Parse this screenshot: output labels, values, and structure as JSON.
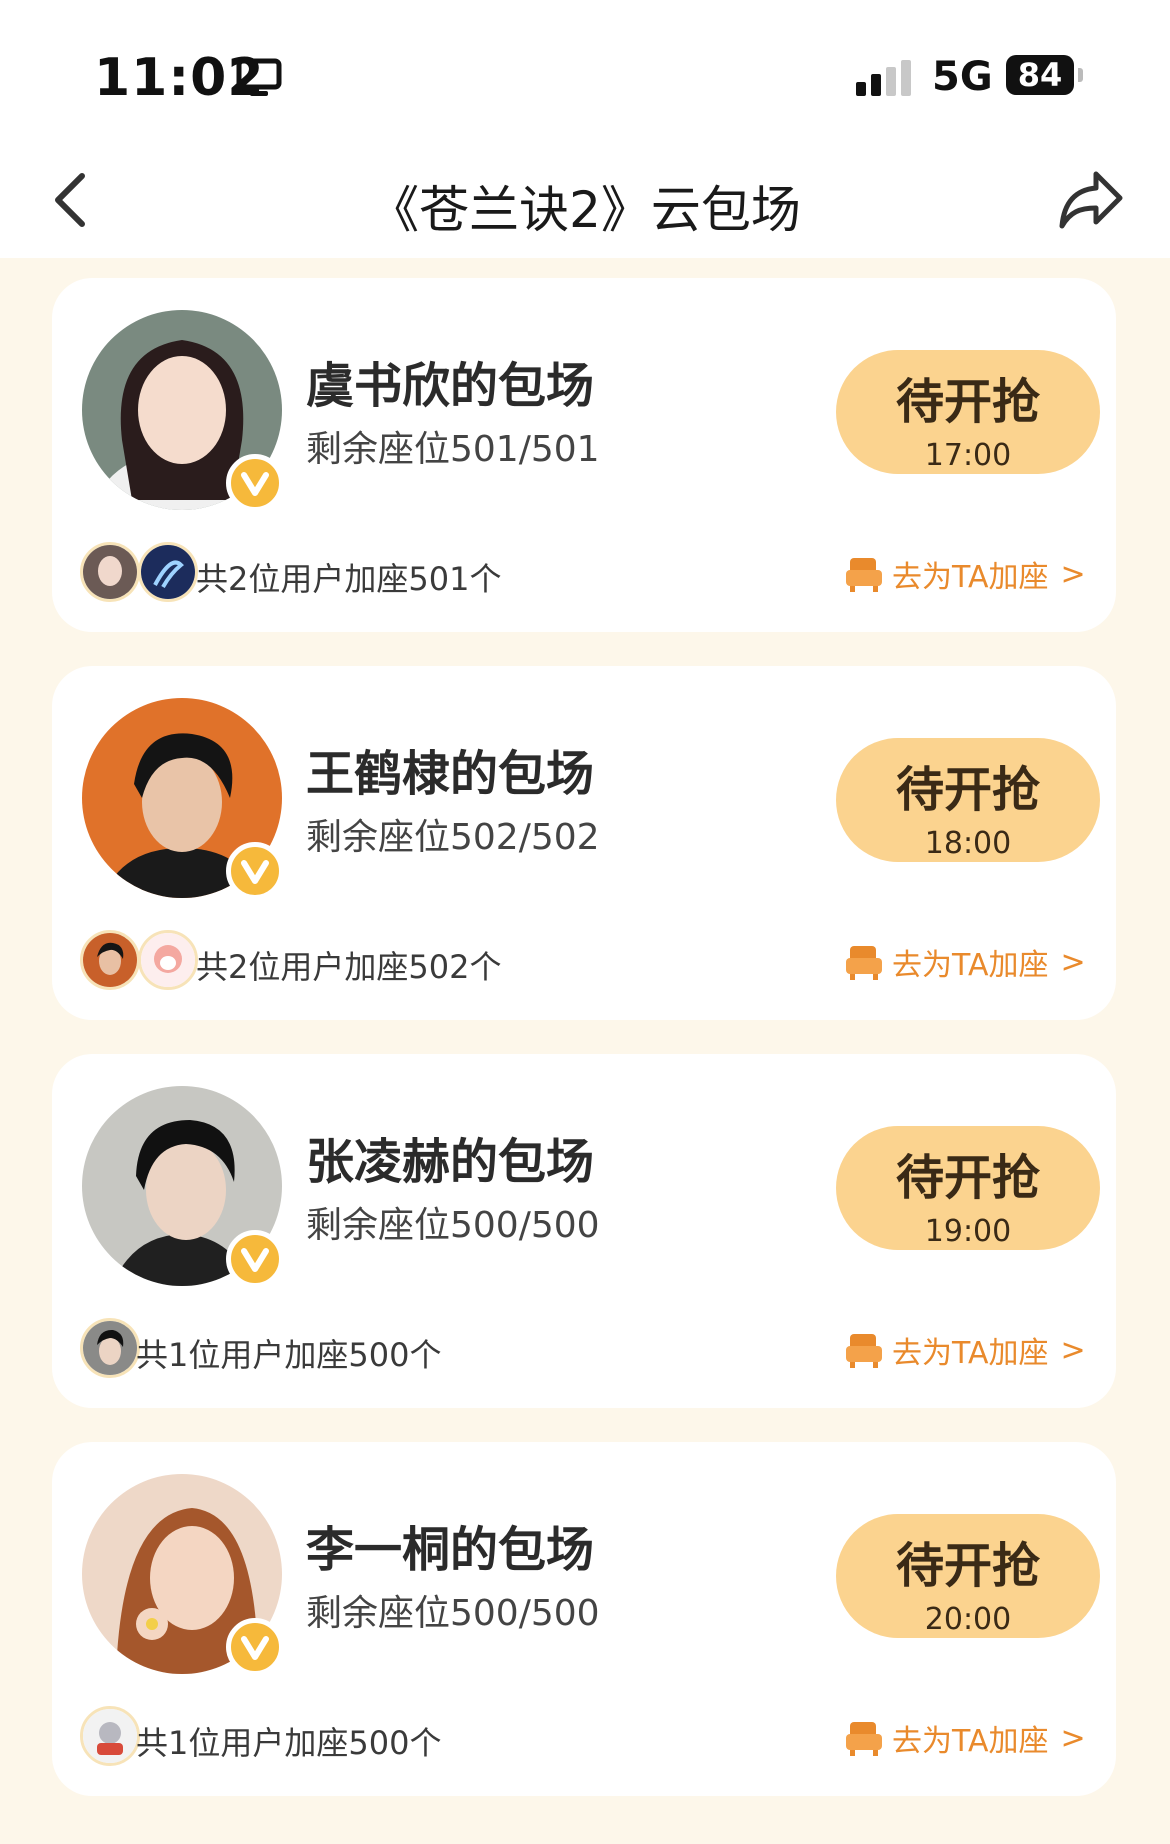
{
  "status_bar": {
    "time": "11:02",
    "network": "5G",
    "battery": "84"
  },
  "nav": {
    "title": "《苍兰诀2》云包场"
  },
  "cards": [
    {
      "host": "虞书欣的包场",
      "seats": "剩余座位501/501",
      "status": "待开抢",
      "time": "17:00",
      "joined": "共2位用户加座501个",
      "add_label": "去为TA加座",
      "arrow": ">",
      "avatar_bg": "#7a8a80",
      "mini_colors": [
        "#6b5a55",
        "#1c2c5c"
      ]
    },
    {
      "host": "王鹤棣的包场",
      "seats": "剩余座位502/502",
      "status": "待开抢",
      "time": "18:00",
      "joined": "共2位用户加座502个",
      "add_label": "去为TA加座",
      "arrow": ">",
      "avatar_bg": "#e0722a",
      "mini_colors": [
        "#c8602a",
        "#f4c0b8"
      ]
    },
    {
      "host": "张凌赫的包场",
      "seats": "剩余座位500/500",
      "status": "待开抢",
      "time": "19:00",
      "joined": "共1位用户加座500个",
      "add_label": "去为TA加座",
      "arrow": ">",
      "avatar_bg": "#c7c7c2",
      "mini_colors": [
        "#8a8a88"
      ]
    },
    {
      "host": "李一桐的包场",
      "seats": "剩余座位500/500",
      "status": "待开抢",
      "time": "20:00",
      "joined": "共1位用户加座500个",
      "add_label": "去为TA加座",
      "arrow": ">",
      "avatar_bg": "#eed8c8",
      "mini_colors": [
        "#f2f2f2"
      ]
    }
  ],
  "colors": {
    "accent": "#e98a2c",
    "pill": "#fbd38f",
    "badge": "#f6b93b",
    "page_bg": "#fdf7ea"
  },
  "icons": {
    "back": "chevron-left-icon",
    "share": "share-icon",
    "seat": "seat-icon",
    "verified": "verified-icon"
  }
}
